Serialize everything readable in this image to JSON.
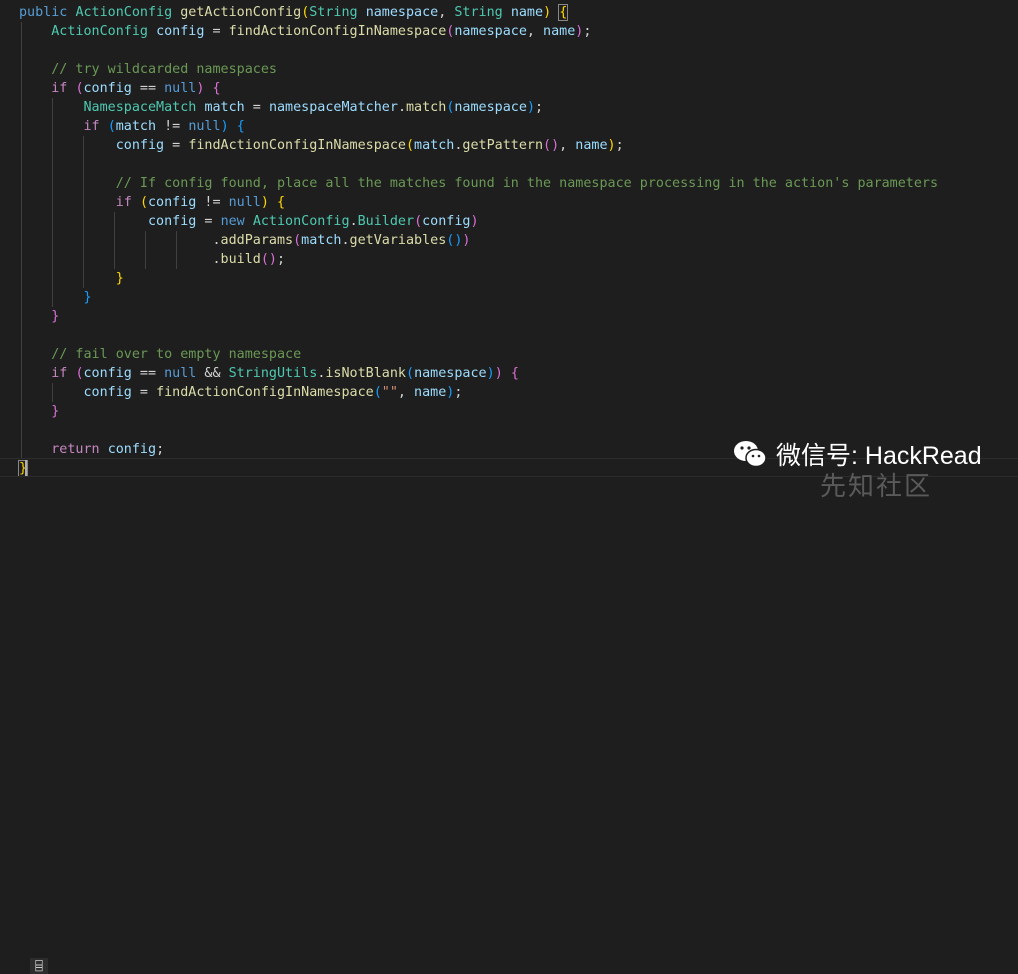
{
  "lines": [
    {
      "tokens": [
        [
          "kw",
          "public"
        ],
        [
          "",
          "ws"
        ],
        [
          "type",
          "ActionConfig"
        ],
        [
          "",
          "ws"
        ],
        [
          "fn",
          "getActionConfig"
        ],
        [
          "b1",
          "("
        ],
        [
          "type",
          "String"
        ],
        [
          "",
          "ws"
        ],
        [
          "var",
          "namespace"
        ],
        [
          "",
          ", "
        ],
        [
          "type",
          "String"
        ],
        [
          "",
          "ws"
        ],
        [
          "var",
          "name"
        ],
        [
          "b1",
          ")"
        ],
        [
          "",
          "ws"
        ],
        [
          "b1 bm",
          "{"
        ]
      ]
    },
    {
      "tokens": [
        [
          "",
          "    "
        ],
        [
          "type",
          "ActionConfig"
        ],
        [
          "",
          "ws"
        ],
        [
          "var",
          "config"
        ],
        [
          "",
          " = "
        ],
        [
          "fn",
          "findActionConfigInNamespace"
        ],
        [
          "b2",
          "("
        ],
        [
          "var",
          "namespace"
        ],
        [
          "",
          ", "
        ],
        [
          "var",
          "name"
        ],
        [
          "b2",
          ")"
        ],
        [
          "",
          ";"
        ]
      ]
    },
    {
      "tokens": []
    },
    {
      "tokens": [
        [
          "",
          "    "
        ],
        [
          "com",
          "// try wildcarded namespaces"
        ]
      ]
    },
    {
      "tokens": [
        [
          "",
          "    "
        ],
        [
          "ctl",
          "if"
        ],
        [
          "",
          "ws"
        ],
        [
          "b2",
          "("
        ],
        [
          "var",
          "config"
        ],
        [
          "",
          " == "
        ],
        [
          "kw",
          "null"
        ],
        [
          "b2",
          ")"
        ],
        [
          "",
          "ws"
        ],
        [
          "b2",
          "{"
        ]
      ]
    },
    {
      "tokens": [
        [
          "",
          "        "
        ],
        [
          "type",
          "NamespaceMatch"
        ],
        [
          "",
          "ws"
        ],
        [
          "var",
          "match"
        ],
        [
          "",
          " = "
        ],
        [
          "var",
          "namespaceMatcher"
        ],
        [
          "",
          "."
        ],
        [
          "fn",
          "match"
        ],
        [
          "b3",
          "("
        ],
        [
          "var",
          "namespace"
        ],
        [
          "b3",
          ")"
        ],
        [
          "",
          ";"
        ]
      ]
    },
    {
      "tokens": [
        [
          "",
          "        "
        ],
        [
          "ctl",
          "if"
        ],
        [
          "",
          "ws"
        ],
        [
          "b3",
          "("
        ],
        [
          "var",
          "match"
        ],
        [
          "",
          " != "
        ],
        [
          "kw",
          "null"
        ],
        [
          "b3",
          ")"
        ],
        [
          "",
          "ws"
        ],
        [
          "b3",
          "{"
        ]
      ]
    },
    {
      "tokens": [
        [
          "",
          "            "
        ],
        [
          "var",
          "config"
        ],
        [
          "",
          " = "
        ],
        [
          "fn",
          "findActionConfigInNamespace"
        ],
        [
          "b1",
          "("
        ],
        [
          "var",
          "match"
        ],
        [
          "",
          "."
        ],
        [
          "fn",
          "getPattern"
        ],
        [
          "b2",
          "()"
        ],
        [
          "",
          ", "
        ],
        [
          "var",
          "name"
        ],
        [
          "b1",
          ")"
        ],
        [
          "",
          ";"
        ]
      ]
    },
    {
      "tokens": []
    },
    {
      "tokens": [
        [
          "",
          "            "
        ],
        [
          "com",
          "// If config found, place all the matches found in the namespace processing in the action's parameters"
        ]
      ]
    },
    {
      "tokens": [
        [
          "",
          "            "
        ],
        [
          "ctl",
          "if"
        ],
        [
          "",
          "ws"
        ],
        [
          "b1",
          "("
        ],
        [
          "var",
          "config"
        ],
        [
          "",
          " != "
        ],
        [
          "kw",
          "null"
        ],
        [
          "b1",
          ")"
        ],
        [
          "",
          "ws"
        ],
        [
          "b1",
          "{"
        ]
      ]
    },
    {
      "tokens": [
        [
          "",
          "                "
        ],
        [
          "var",
          "config"
        ],
        [
          "",
          " = "
        ],
        [
          "kw",
          "new"
        ],
        [
          "",
          "ws"
        ],
        [
          "type",
          "ActionConfig"
        ],
        [
          "",
          "."
        ],
        [
          "type",
          "Builder"
        ],
        [
          "b2",
          "("
        ],
        [
          "var",
          "config"
        ],
        [
          "b2",
          ")"
        ]
      ]
    },
    {
      "tokens": [
        [
          "",
          "                        "
        ],
        [
          "",
          "."
        ],
        [
          "fn",
          "addParams"
        ],
        [
          "b2",
          "("
        ],
        [
          "var",
          "match"
        ],
        [
          "",
          "."
        ],
        [
          "fn",
          "getVariables"
        ],
        [
          "b3",
          "()"
        ],
        [
          "b2",
          ")"
        ]
      ]
    },
    {
      "tokens": [
        [
          "",
          "                        "
        ],
        [
          "",
          "."
        ],
        [
          "fn",
          "build"
        ],
        [
          "b2",
          "()"
        ],
        [
          "",
          ";"
        ]
      ]
    },
    {
      "tokens": [
        [
          "",
          "            "
        ],
        [
          "b1",
          "}"
        ]
      ]
    },
    {
      "tokens": [
        [
          "",
          "        "
        ],
        [
          "b3",
          "}"
        ]
      ]
    },
    {
      "tokens": [
        [
          "",
          "    "
        ],
        [
          "b2",
          "}"
        ]
      ]
    },
    {
      "tokens": []
    },
    {
      "tokens": [
        [
          "",
          "    "
        ],
        [
          "com",
          "// fail over to empty namespace"
        ]
      ]
    },
    {
      "tokens": [
        [
          "",
          "    "
        ],
        [
          "ctl",
          "if"
        ],
        [
          "",
          "ws"
        ],
        [
          "b2",
          "("
        ],
        [
          "var",
          "config"
        ],
        [
          "",
          " == "
        ],
        [
          "kw",
          "null"
        ],
        [
          "",
          " && "
        ],
        [
          "type",
          "StringUtils"
        ],
        [
          "",
          "."
        ],
        [
          "fn",
          "isNotBlank"
        ],
        [
          "b3",
          "("
        ],
        [
          "var",
          "namespace"
        ],
        [
          "b3",
          ")"
        ],
        [
          "b2",
          ")"
        ],
        [
          "",
          "ws"
        ],
        [
          "b2",
          "{"
        ]
      ]
    },
    {
      "tokens": [
        [
          "",
          "        "
        ],
        [
          "var",
          "config"
        ],
        [
          "",
          " = "
        ],
        [
          "fn",
          "findActionConfigInNamespace"
        ],
        [
          "b3",
          "("
        ],
        [
          "str",
          "\"\""
        ],
        [
          "",
          ", "
        ],
        [
          "var",
          "name"
        ],
        [
          "b3",
          ")"
        ],
        [
          "",
          ";"
        ]
      ]
    },
    {
      "tokens": [
        [
          "",
          "    "
        ],
        [
          "b2",
          "}"
        ]
      ]
    },
    {
      "tokens": []
    },
    {
      "tokens": [
        [
          "",
          "    "
        ],
        [
          "ctl",
          "return"
        ],
        [
          "",
          "ws"
        ],
        [
          "var",
          "config"
        ],
        [
          "",
          ";"
        ]
      ]
    },
    {
      "tokens": [
        [
          "b1 bm",
          "}"
        ]
      ]
    }
  ],
  "guides": [
    [],
    [
      0
    ],
    [
      0
    ],
    [
      0
    ],
    [
      0
    ],
    [
      0,
      1
    ],
    [
      0,
      1
    ],
    [
      0,
      1,
      2
    ],
    [
      0,
      1,
      2
    ],
    [
      0,
      1,
      2
    ],
    [
      0,
      1,
      2
    ],
    [
      0,
      1,
      2,
      3
    ],
    [
      0,
      1,
      2,
      3,
      4,
      5
    ],
    [
      0,
      1,
      2,
      3,
      4,
      5
    ],
    [
      0,
      1,
      2
    ],
    [
      0,
      1
    ],
    [
      0
    ],
    [
      0
    ],
    [
      0
    ],
    [
      0
    ],
    [
      0,
      1
    ],
    [
      0
    ],
    [
      0
    ],
    [
      0
    ],
    []
  ],
  "watermark": {
    "text": "微信号: HackRead",
    "site": "先知社区"
  },
  "gutter_icon_glyph": "⌸"
}
